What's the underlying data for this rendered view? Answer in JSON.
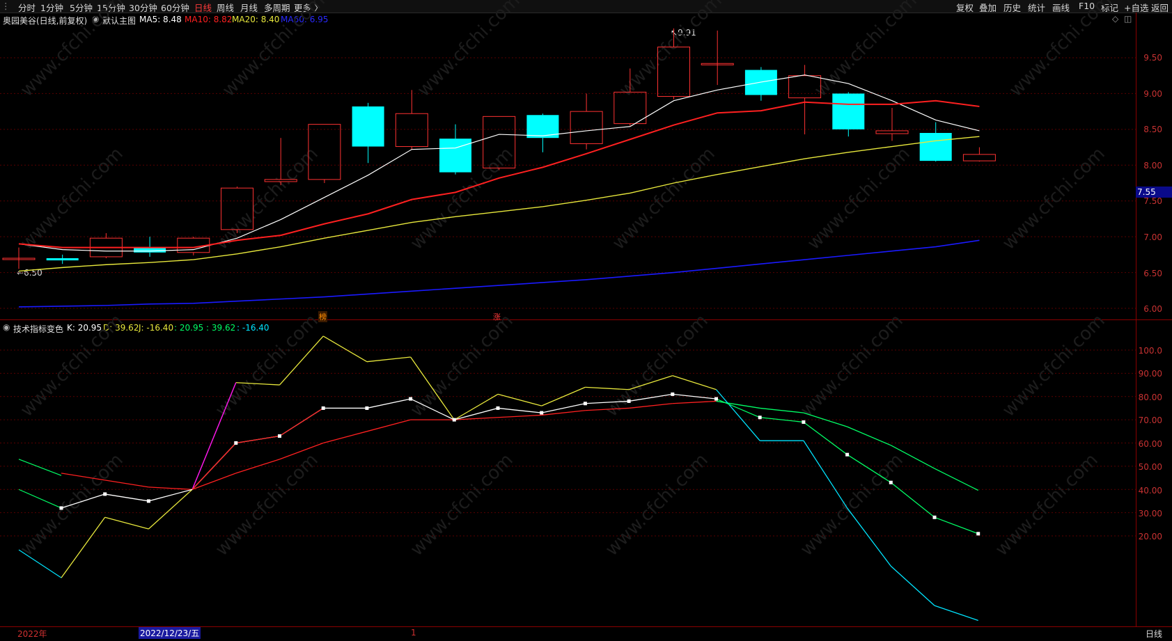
{
  "topbar": {
    "left_items": [
      "分时",
      "1分钟",
      "5分钟",
      "15分钟",
      "30分钟",
      "60分钟",
      "日线",
      "周线",
      "月线",
      "多周期",
      "更多 〉"
    ],
    "active": "日线",
    "right_items": [
      "复权",
      "叠加",
      "历史",
      "统计",
      "画线",
      "F10",
      "标记",
      "+自选",
      "返回"
    ]
  },
  "main_header": {
    "title": "奥园美谷(日线,前复权)",
    "template": "默认主图",
    "ma5": "MA5: 8.48",
    "ma10": "MA10: 8.82",
    "ma20": "MA20: 8.40",
    "ma60": "MA60: 6.95"
  },
  "sub_header": {
    "name": "技术指标变色",
    "k": "K: 20.95",
    "d": "D: 39.62",
    "j": "J: -16.40",
    "v1": ": 20.95",
    "v2": ": 39.62",
    "v3": ": -16.40"
  },
  "price_axis": [
    "9.50",
    "9.00",
    "8.50",
    "8.00",
    "7.50",
    "7.00",
    "6.50",
    "6.00"
  ],
  "current_price": "7.55",
  "annotations": {
    "high": "9.91",
    "low": "6.50"
  },
  "markers": [
    "榜",
    "涨"
  ],
  "ind_axis": [
    "100.0",
    "90.00",
    "80.00",
    "70.00",
    "60.00",
    "50.00",
    "40.00",
    "30.00",
    "20.00"
  ],
  "bottom": {
    "year": "2022年",
    "date": "2022/12/23/五",
    "tick": "1",
    "period": "日线"
  },
  "watermark": "www.cfchi.com",
  "colors": {
    "up": "#ff3232",
    "down": "#00ffff",
    "ma5": "#ffffff",
    "ma10": "#ff2020",
    "ma20": "#e8e83c",
    "ma60": "#1a1aff"
  },
  "chart_data": [
    {
      "type": "candlestick",
      "title": "奥园美谷(日线,前复权)",
      "ylim": [
        5.9,
        9.9
      ],
      "candles": [
        {
          "o": 6.7,
          "h": 6.85,
          "l": 6.55,
          "c": 6.7,
          "dir": "up"
        },
        {
          "o": 6.7,
          "h": 6.75,
          "l": 6.62,
          "c": 6.67,
          "dir": "down"
        },
        {
          "o": 6.72,
          "h": 7.05,
          "l": 6.7,
          "c": 6.98,
          "dir": "up"
        },
        {
          "o": 6.85,
          "h": 7.0,
          "l": 6.72,
          "c": 6.78,
          "dir": "down"
        },
        {
          "o": 6.78,
          "h": 7.0,
          "l": 6.74,
          "c": 6.98,
          "dir": "up"
        },
        {
          "o": 7.1,
          "h": 7.7,
          "l": 7.05,
          "c": 7.68,
          "dir": "up"
        },
        {
          "o": 7.77,
          "h": 8.38,
          "l": 7.72,
          "c": 7.8,
          "dir": "up"
        },
        {
          "o": 7.8,
          "h": 8.57,
          "l": 7.75,
          "c": 8.57,
          "dir": "up"
        },
        {
          "o": 8.82,
          "h": 8.87,
          "l": 8.03,
          "c": 8.26,
          "dir": "down"
        },
        {
          "o": 8.26,
          "h": 9.05,
          "l": 8.22,
          "c": 8.72,
          "dir": "up"
        },
        {
          "o": 8.37,
          "h": 8.57,
          "l": 7.87,
          "c": 7.9,
          "dir": "down"
        },
        {
          "o": 7.96,
          "h": 8.68,
          "l": 7.93,
          "c": 8.68,
          "dir": "up"
        },
        {
          "o": 8.7,
          "h": 8.72,
          "l": 8.18,
          "c": 8.38,
          "dir": "down"
        },
        {
          "o": 8.3,
          "h": 9.0,
          "l": 8.22,
          "c": 8.75,
          "dir": "up"
        },
        {
          "o": 8.58,
          "h": 9.35,
          "l": 8.55,
          "c": 9.02,
          "dir": "up"
        },
        {
          "o": 8.96,
          "h": 9.91,
          "l": 8.92,
          "c": 9.65,
          "dir": "up"
        },
        {
          "o": 9.42,
          "h": 9.88,
          "l": 9.12,
          "c": 9.42,
          "dir": "up"
        },
        {
          "o": 9.33,
          "h": 9.37,
          "l": 8.9,
          "c": 8.98,
          "dir": "down"
        },
        {
          "o": 8.94,
          "h": 9.4,
          "l": 8.43,
          "c": 9.25,
          "dir": "up"
        },
        {
          "o": 9.0,
          "h": 9.02,
          "l": 8.4,
          "c": 8.5,
          "dir": "down"
        },
        {
          "o": 8.44,
          "h": 8.8,
          "l": 8.34,
          "c": 8.48,
          "dir": "up"
        },
        {
          "o": 8.45,
          "h": 8.6,
          "l": 8.05,
          "c": 8.06,
          "dir": "down"
        },
        {
          "o": 8.06,
          "h": 8.25,
          "l": 8.05,
          "c": 8.15,
          "dir": "up"
        }
      ],
      "series": [
        {
          "name": "MA5",
          "values": [
            6.9,
            6.82,
            6.8,
            6.8,
            6.82,
            6.98,
            7.24,
            7.55,
            7.86,
            8.22,
            8.24,
            8.43,
            8.41,
            8.48,
            8.54,
            8.9,
            9.05,
            9.16,
            9.26,
            9.14,
            8.9,
            8.63,
            8.48
          ]
        },
        {
          "name": "MA10",
          "values": [
            6.9,
            6.85,
            6.85,
            6.85,
            6.85,
            6.95,
            7.02,
            7.18,
            7.32,
            7.52,
            7.62,
            7.82,
            7.97,
            8.16,
            8.36,
            8.56,
            8.73,
            8.76,
            8.88,
            8.85,
            8.85,
            8.9,
            8.82
          ]
        },
        {
          "name": "MA20",
          "values": [
            6.52,
            6.57,
            6.61,
            6.64,
            6.68,
            6.76,
            6.86,
            6.98,
            7.09,
            7.2,
            7.28,
            7.35,
            7.42,
            7.51,
            7.61,
            7.75,
            7.87,
            7.98,
            8.09,
            8.18,
            8.26,
            8.34,
            8.4
          ]
        },
        {
          "name": "MA60",
          "values": [
            6.02,
            6.03,
            6.04,
            6.06,
            6.07,
            6.1,
            6.13,
            6.16,
            6.2,
            6.24,
            6.28,
            6.32,
            6.36,
            6.4,
            6.45,
            6.5,
            6.56,
            6.62,
            6.68,
            6.74,
            6.8,
            6.86,
            6.95
          ]
        }
      ]
    },
    {
      "type": "line",
      "title": "技术指标变色",
      "ylim": [
        -20,
        112
      ],
      "series": [
        {
          "name": "K",
          "values": [
            32,
            38,
            35,
            40,
            60,
            63,
            75,
            75,
            79,
            70,
            75,
            73,
            77,
            78,
            81,
            79,
            71,
            69,
            55,
            43,
            28,
            20.95
          ]
        },
        {
          "name": "D",
          "values": [
            47,
            44,
            41,
            40,
            47,
            53,
            60,
            65,
            70,
            70,
            71,
            72,
            74,
            75,
            77,
            78,
            75,
            73,
            67,
            59,
            49,
            39.62
          ]
        },
        {
          "name": "J",
          "values": [
            2,
            28,
            23,
            40,
            86,
            85,
            106,
            95,
            97,
            70,
            81,
            76,
            84,
            83,
            89,
            83,
            61,
            61,
            32,
            7,
            -10,
            -16.4
          ]
        },
        {
          "name": "J2",
          "values": [
            14,
            2
          ]
        },
        {
          "name": "D2",
          "values": [
            53,
            46
          ]
        },
        {
          "name": "K2",
          "values": [
            40,
            32
          ]
        }
      ]
    }
  ]
}
